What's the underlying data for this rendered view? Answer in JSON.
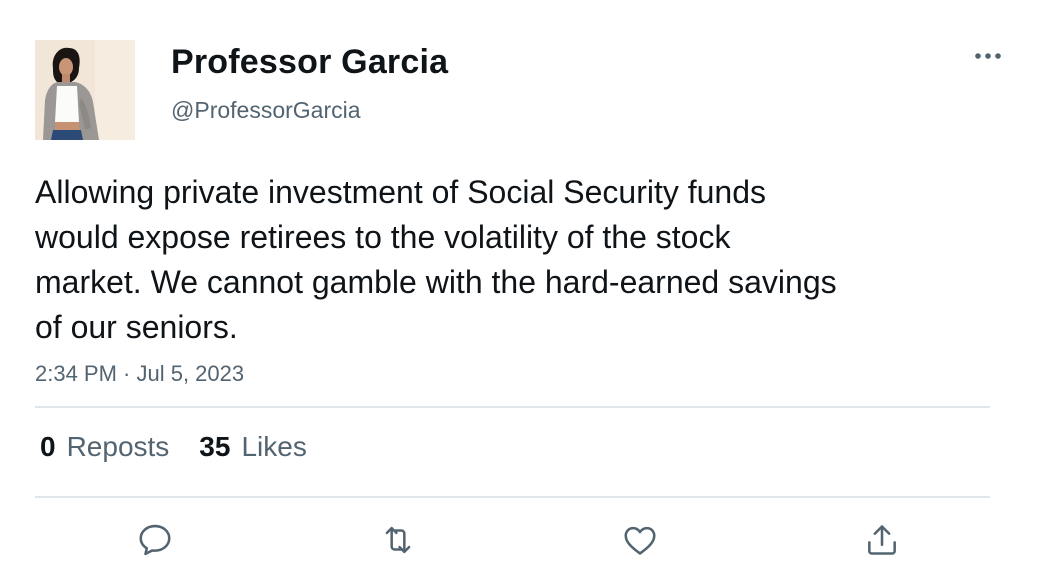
{
  "author": {
    "display_name": "Professor Garcia",
    "handle": "@ProfessorGarcia",
    "avatar_icon": "profile-photo"
  },
  "tweet": {
    "text": "Allowing private investment of Social Security funds\nwould expose retirees to the volatility of the stock\nmarket. We cannot gamble with the hard-earned savings\nof our seniors.",
    "timestamp": "2:34 PM · Jul 5, 2023"
  },
  "stats": {
    "reposts_count": "0",
    "reposts_label": "Reposts",
    "likes_count": "35",
    "likes_label": "Likes"
  },
  "actions": {
    "reply_icon": "speech-bubble-icon",
    "repost_icon": "retweet-arrows-icon",
    "like_icon": "heart-icon",
    "share_icon": "share-upload-icon",
    "more_icon": "ellipsis-icon"
  },
  "colors": {
    "text_primary": "#0f1419",
    "text_secondary": "#536471",
    "divider": "#e1e6ea",
    "icon": "#536471"
  }
}
